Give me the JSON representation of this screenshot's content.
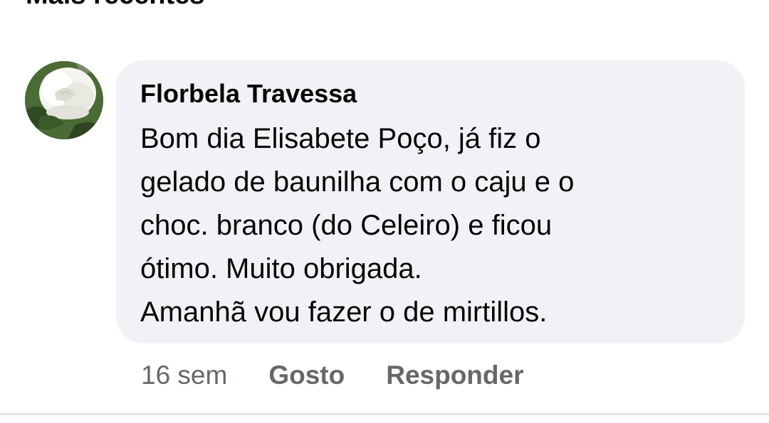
{
  "section": {
    "title": "Mais recentes"
  },
  "comment": {
    "author": "Florbela Travessa",
    "avatar_icon": "white-rose-avatar",
    "text_lines": [
      "Bom dia Elisabete Poço, já fiz o",
      "gelado de baunilha com o caju e o",
      "choc. branco (do Celeiro) e ficou",
      "ótimo. Muito obrigada.",
      "Amanhã vou fazer o de mirtillos."
    ],
    "timestamp": "16 sem",
    "like_label": "Gosto",
    "reply_label": "Responder"
  },
  "colors": {
    "bubble_background": "#f0f2f5",
    "secondary_text": "#65676b",
    "primary_text": "#050505",
    "divider": "#e4e6eb"
  }
}
